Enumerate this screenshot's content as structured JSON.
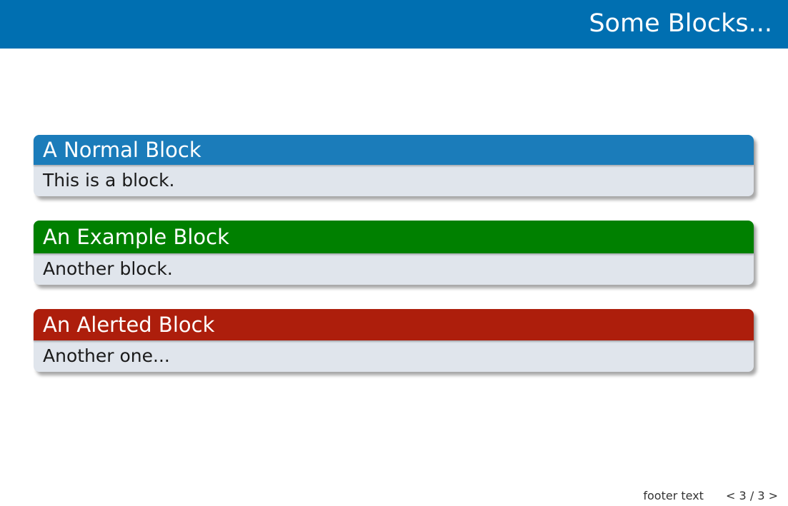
{
  "frame": {
    "title": "Some Blocks..."
  },
  "blocks": [
    {
      "title": "A Normal Block",
      "body": "This is a block.",
      "color": "#1b7cba"
    },
    {
      "title": "An Example Block",
      "body": "Another block.",
      "color": "#008000"
    },
    {
      "title": "An Alerted Block",
      "body": "Another one...",
      "color": "#ad1e0c"
    }
  ],
  "footer": {
    "text": "footer text",
    "prev": "<",
    "page_current": "3",
    "separator": "/",
    "page_total": "3",
    "next": ">"
  }
}
